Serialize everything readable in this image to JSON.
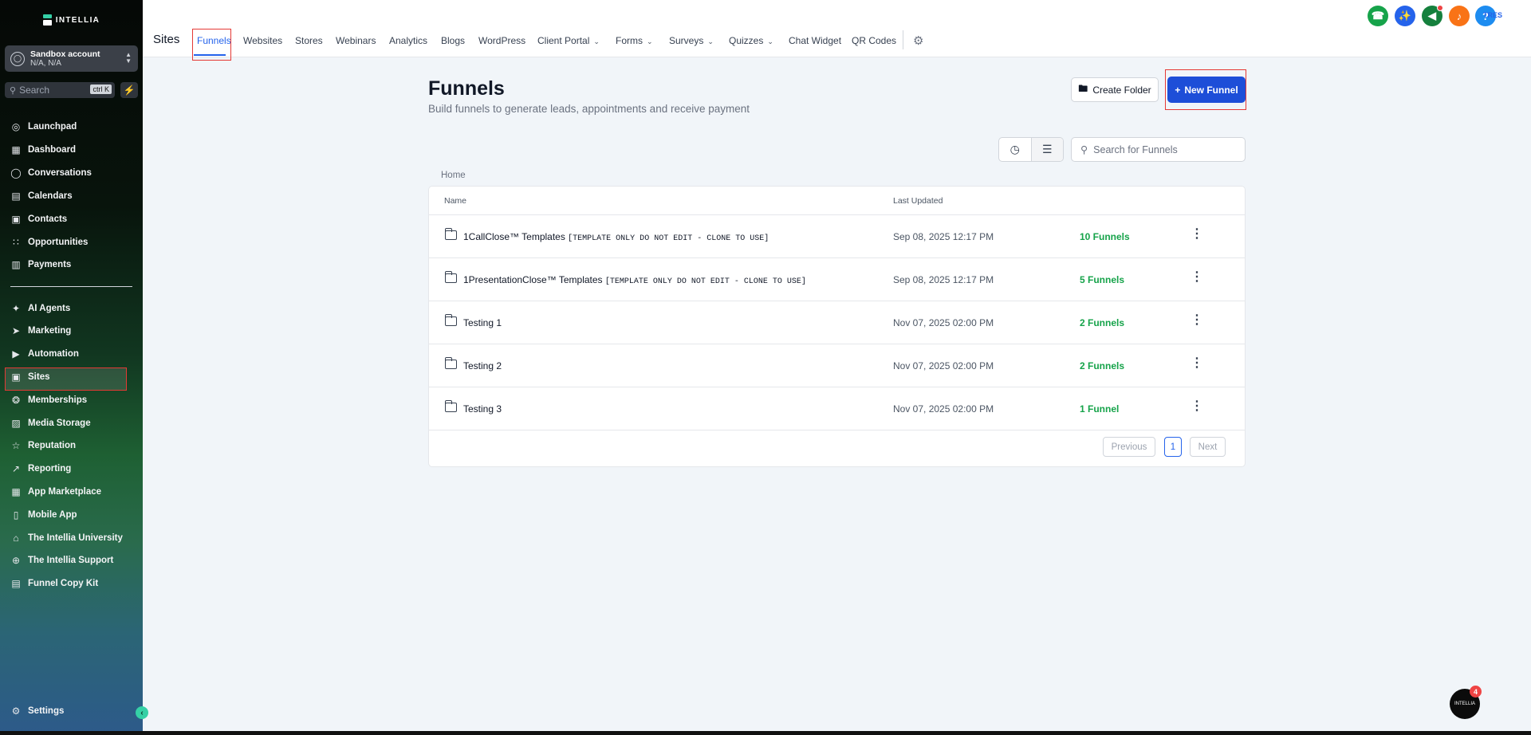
{
  "sidebar": {
    "logo_text": "INTELLIA",
    "account": {
      "name": "Sandbox account",
      "location": "N/A, N/A"
    },
    "search": {
      "placeholder": "Search",
      "shortcut": "ctrl K"
    },
    "items": [
      {
        "label": "Launchpad",
        "icon": "launchpad-icon"
      },
      {
        "label": "Dashboard",
        "icon": "dashboard-icon"
      },
      {
        "label": "Conversations",
        "icon": "chat-icon"
      },
      {
        "label": "Calendars",
        "icon": "calendar-icon"
      },
      {
        "label": "Contacts",
        "icon": "contacts-icon"
      },
      {
        "label": "Opportunities",
        "icon": "opportunities-icon"
      },
      {
        "label": "Payments",
        "icon": "payments-icon"
      },
      {
        "label": "AI Agents",
        "icon": "sparkle-icon"
      },
      {
        "label": "Marketing",
        "icon": "send-icon"
      },
      {
        "label": "Automation",
        "icon": "automation-icon"
      },
      {
        "label": "Sites",
        "icon": "sites-icon",
        "active": true
      },
      {
        "label": "Memberships",
        "icon": "award-icon"
      },
      {
        "label": "Media Storage",
        "icon": "image-icon"
      },
      {
        "label": "Reputation",
        "icon": "star-icon"
      },
      {
        "label": "Reporting",
        "icon": "chart-line-icon"
      },
      {
        "label": "App Marketplace",
        "icon": "grid-plus-icon"
      },
      {
        "label": "Mobile App",
        "icon": "mobile-icon"
      },
      {
        "label": "The Intellia University",
        "icon": "graduation-cap-icon"
      },
      {
        "label": "The Intellia Support",
        "icon": "support-icon"
      },
      {
        "label": "Funnel Copy Kit",
        "icon": "document-icon"
      }
    ],
    "settings_label": "Settings"
  },
  "topbar": {
    "section_title": "Sites",
    "tabs": [
      {
        "label": "Funnels",
        "active": true
      },
      {
        "label": "Websites"
      },
      {
        "label": "Stores"
      },
      {
        "label": "Webinars"
      },
      {
        "label": "Analytics"
      },
      {
        "label": "Blogs"
      },
      {
        "label": "WordPress"
      },
      {
        "label": "Client Portal",
        "dropdown": true
      },
      {
        "label": "Forms",
        "dropdown": true
      },
      {
        "label": "Surveys",
        "dropdown": true
      },
      {
        "label": "Quizzes",
        "dropdown": true
      },
      {
        "label": "Chat Widget"
      },
      {
        "label": "QR Codes"
      }
    ],
    "header_buttons": [
      {
        "icon": "phone-icon",
        "color": "#16a34a"
      },
      {
        "icon": "magic-icon",
        "color": "#2563eb"
      },
      {
        "icon": "megaphone-icon",
        "color": "#15803d",
        "dot": true
      },
      {
        "icon": "bell-icon",
        "color": "#f97316"
      },
      {
        "icon": "help-icon",
        "color": "#1d8cf0"
      }
    ],
    "user_initials": "TRES"
  },
  "main": {
    "title": "Funnels",
    "subtitle": "Build funnels to generate leads, appointments and receive payment",
    "create_folder_label": "Create Folder",
    "new_funnel_label": "New Funnel",
    "search_placeholder": "Search for Funnels",
    "breadcrumb": "Home",
    "columns": {
      "name": "Name",
      "updated": "Last Updated"
    },
    "rows": [
      {
        "name": "1CallClose™ Templates ",
        "note": "[TEMPLATE ONLY DO NOT EDIT - CLONE TO USE]",
        "updated": "Sep 08, 2025 12:17 PM",
        "count": "10 Funnels"
      },
      {
        "name": "1PresentationClose™ Templates ",
        "note": "[TEMPLATE ONLY DO NOT EDIT - CLONE TO USE]",
        "updated": "Sep 08, 2025 12:17 PM",
        "count": "5 Funnels"
      },
      {
        "name": "Testing 1",
        "note": "",
        "updated": "Nov 07, 2025 02:00 PM",
        "count": "2 Funnels"
      },
      {
        "name": "Testing 2",
        "note": "",
        "updated": "Nov 07, 2025 02:00 PM",
        "count": "2 Funnels"
      },
      {
        "name": "Testing 3",
        "note": "",
        "updated": "Nov 07, 2025 02:00 PM",
        "count": "1 Funnel"
      }
    ],
    "pagination": {
      "previous": "Previous",
      "current": "1",
      "next": "Next"
    }
  },
  "chat_widget": {
    "label": "INTELLIA",
    "badge": "4"
  }
}
